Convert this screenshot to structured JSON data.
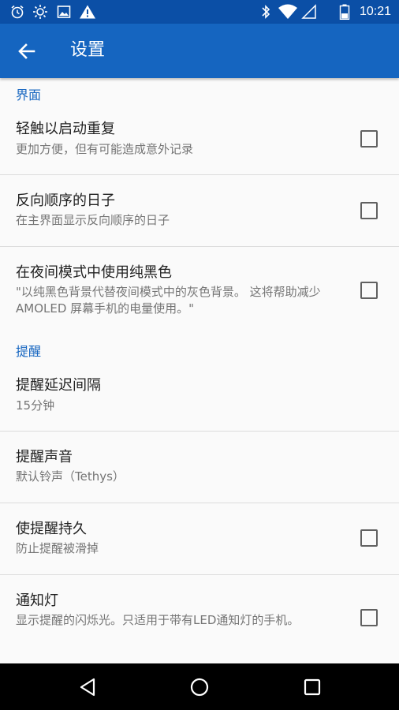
{
  "status_bar": {
    "time": "10:21",
    "left_icons": [
      "alarm-icon",
      "brightness-icon",
      "image-icon",
      "warning-icon"
    ],
    "right_icons": [
      "bluetooth-icon",
      "wifi-icon",
      "signal-icon",
      "battery-icon"
    ]
  },
  "app_bar": {
    "title": "设置",
    "back_icon": "arrow-back-icon",
    "color": "#1565c0"
  },
  "sections": [
    {
      "header": "界面",
      "items": [
        {
          "title": "轻触以启动重复",
          "summary": "更加方便，但有可能造成意外记录",
          "checkbox": true,
          "checked": false
        },
        {
          "title": "反向顺序的日子",
          "summary": "在主界面显示反向顺序的日子",
          "checkbox": true,
          "checked": false
        },
        {
          "title": "在夜间模式中使用纯黑色",
          "summary": "\"以纯黑色背景代替夜间模式中的灰色背景。 这将帮助减少 AMOLED 屏幕手机的电量使用。\"",
          "checkbox": true,
          "checked": false
        }
      ]
    },
    {
      "header": "提醒",
      "items": [
        {
          "title": "提醒延迟间隔",
          "summary": "15分钟",
          "checkbox": false
        },
        {
          "title": "提醒声音",
          "summary": "默认铃声（Tethys）",
          "checkbox": false
        },
        {
          "title": "使提醒持久",
          "summary": "防止提醒被滑掉",
          "checkbox": true,
          "checked": false
        },
        {
          "title": "通知灯",
          "summary": "显示提醒的闪烁光。只适用于带有LED通知灯的手机。",
          "checkbox": true,
          "checked": false
        }
      ]
    }
  ],
  "nav_bar": {
    "buttons": [
      "back-triangle-icon",
      "home-circle-icon",
      "recents-square-icon"
    ]
  }
}
